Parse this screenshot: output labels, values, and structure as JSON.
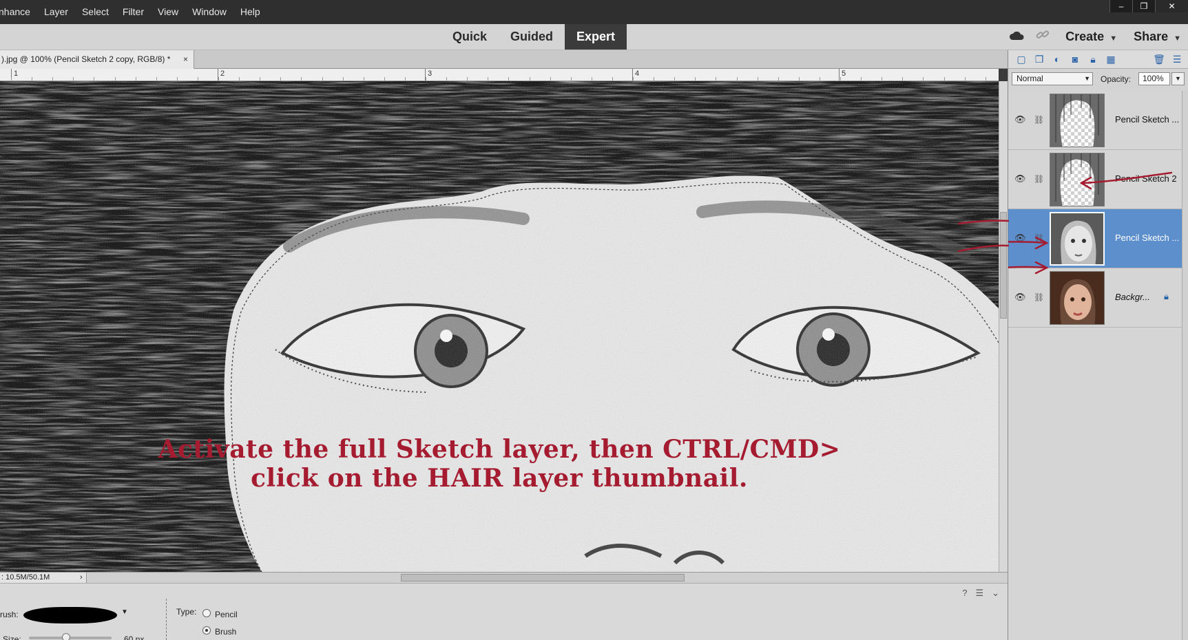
{
  "menubar": {
    "items": [
      "nhance",
      "Layer",
      "Select",
      "Filter",
      "View",
      "Window",
      "Help"
    ],
    "window_controls": [
      "–",
      "❐",
      "✕"
    ]
  },
  "modebar": {
    "modes": [
      "Quick",
      "Guided",
      "Expert"
    ],
    "active_mode": "Expert",
    "create_label": "Create",
    "share_label": "Share",
    "icons": [
      "cloud-icon",
      "link-icon"
    ]
  },
  "document": {
    "tab_title": ").jpg @ 100% (Pencil Sketch 2 copy, RGB/8) *",
    "close": "×"
  },
  "ruler": {
    "labels": [
      "1",
      "2",
      "3",
      "4",
      "5"
    ]
  },
  "canvas": {
    "annotation_line1": "Activate the full Sketch layer, then CTRL/CMD>",
    "annotation_line2": "click on the HAIR layer thumbnail."
  },
  "statusbar": {
    "doc_info": ": 10.5M/50.1M",
    "arrow": "›"
  },
  "options": {
    "brush_label": "rush:",
    "size_label": "Size:",
    "size_value": "60 px",
    "type_label": "Type:",
    "type_options": [
      "Pencil",
      "Brush"
    ],
    "type_selected": "Brush",
    "help_icon": "?"
  },
  "layers_panel": {
    "blend_mode": "Normal",
    "opacity_label": "Opacity:",
    "opacity_value": "100%",
    "layers": [
      {
        "name": "Pencil Sketch ...",
        "visible": true,
        "selected": false,
        "thumb": "hair-sketch-transparent"
      },
      {
        "name": "Pencil Sketch 2",
        "visible": true,
        "selected": false,
        "thumb": "hair-sketch-transparent"
      },
      {
        "name": "Pencil Sketch ...",
        "visible": true,
        "selected": true,
        "thumb": "full-sketch"
      },
      {
        "name": "Backgr...",
        "visible": true,
        "selected": false,
        "thumb": "color-photo",
        "locked": true
      }
    ]
  },
  "colors": {
    "accent_blue": "#5d8fcd",
    "annotation_red": "#a51c30",
    "menubar_bg": "#2f2f2f"
  }
}
